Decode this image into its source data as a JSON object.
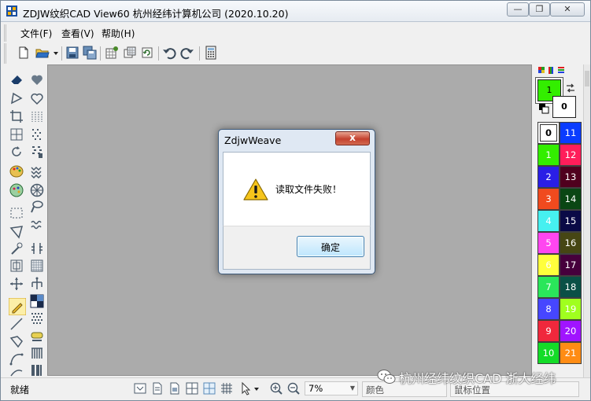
{
  "window": {
    "title": "ZDJW纹织CAD View60 杭州经纬计算机公司 (2020.10.20)"
  },
  "menu": [
    {
      "label": "文件(F)"
    },
    {
      "label": "查看(V)"
    },
    {
      "label": "帮助(H)"
    }
  ],
  "toolbar": {
    "icons": [
      "new-file-icon",
      "open-folder-icon",
      "dropdown-arrow-icon",
      "save-icon",
      "save-all-icon",
      "grid-settings-icon",
      "copy-grid-icon",
      "refresh-icon",
      "undo-icon",
      "redo-icon",
      "calculator-icon"
    ]
  },
  "palette": {
    "current_fg": "1",
    "current_bg": "0",
    "swatches": [
      {
        "label": "0",
        "color": "#ffffff",
        "text_color": "#000000"
      },
      {
        "label": "11",
        "color": "#0a3cff",
        "text_color": "#ffffff"
      },
      {
        "label": "1",
        "color": "#33ee00",
        "text_color": "#ffffff"
      },
      {
        "label": "12",
        "color": "#ff1e5a",
        "text_color": "#ffffff"
      },
      {
        "label": "2",
        "color": "#2a1ee6",
        "text_color": "#ffffff"
      },
      {
        "label": "13",
        "color": "#50001e",
        "text_color": "#ffffff"
      },
      {
        "label": "3",
        "color": "#f04a1e",
        "text_color": "#ffffff"
      },
      {
        "label": "14",
        "color": "#0a4614",
        "text_color": "#ffffff"
      },
      {
        "label": "4",
        "color": "#46f0f0",
        "text_color": "#ffffff"
      },
      {
        "label": "15",
        "color": "#0a0a46",
        "text_color": "#ffffff"
      },
      {
        "label": "5",
        "color": "#ff46f0",
        "text_color": "#ffffff"
      },
      {
        "label": "16",
        "color": "#464614",
        "text_color": "#ffffff"
      },
      {
        "label": "6",
        "color": "#ffff3c",
        "text_color": "#ffffff"
      },
      {
        "label": "17",
        "color": "#46003c",
        "text_color": "#ffffff"
      },
      {
        "label": "7",
        "color": "#2ae65a",
        "text_color": "#ffffff"
      },
      {
        "label": "18",
        "color": "#0a5046",
        "text_color": "#ffffff"
      },
      {
        "label": "8",
        "color": "#4646ff",
        "text_color": "#ffffff"
      },
      {
        "label": "19",
        "color": "#a0ff1e",
        "text_color": "#ffffff"
      },
      {
        "label": "9",
        "color": "#f0283c",
        "text_color": "#ffffff"
      },
      {
        "label": "20",
        "color": "#a014ff",
        "text_color": "#ffffff"
      },
      {
        "label": "10",
        "color": "#14dc28",
        "text_color": "#ffffff"
      },
      {
        "label": "21",
        "color": "#ff8c14",
        "text_color": "#ffffff"
      }
    ]
  },
  "status": {
    "ready": "就绪",
    "zoom": "7%",
    "color_label": "颜色",
    "mouse_label": "鼠标位置"
  },
  "watermark": {
    "text": "杭州经纬纹织CAD 浙大经纬"
  },
  "dialog": {
    "title": "ZdjwWeave",
    "close": "x",
    "message": "读取文件失败！",
    "ok_label": "确定"
  }
}
